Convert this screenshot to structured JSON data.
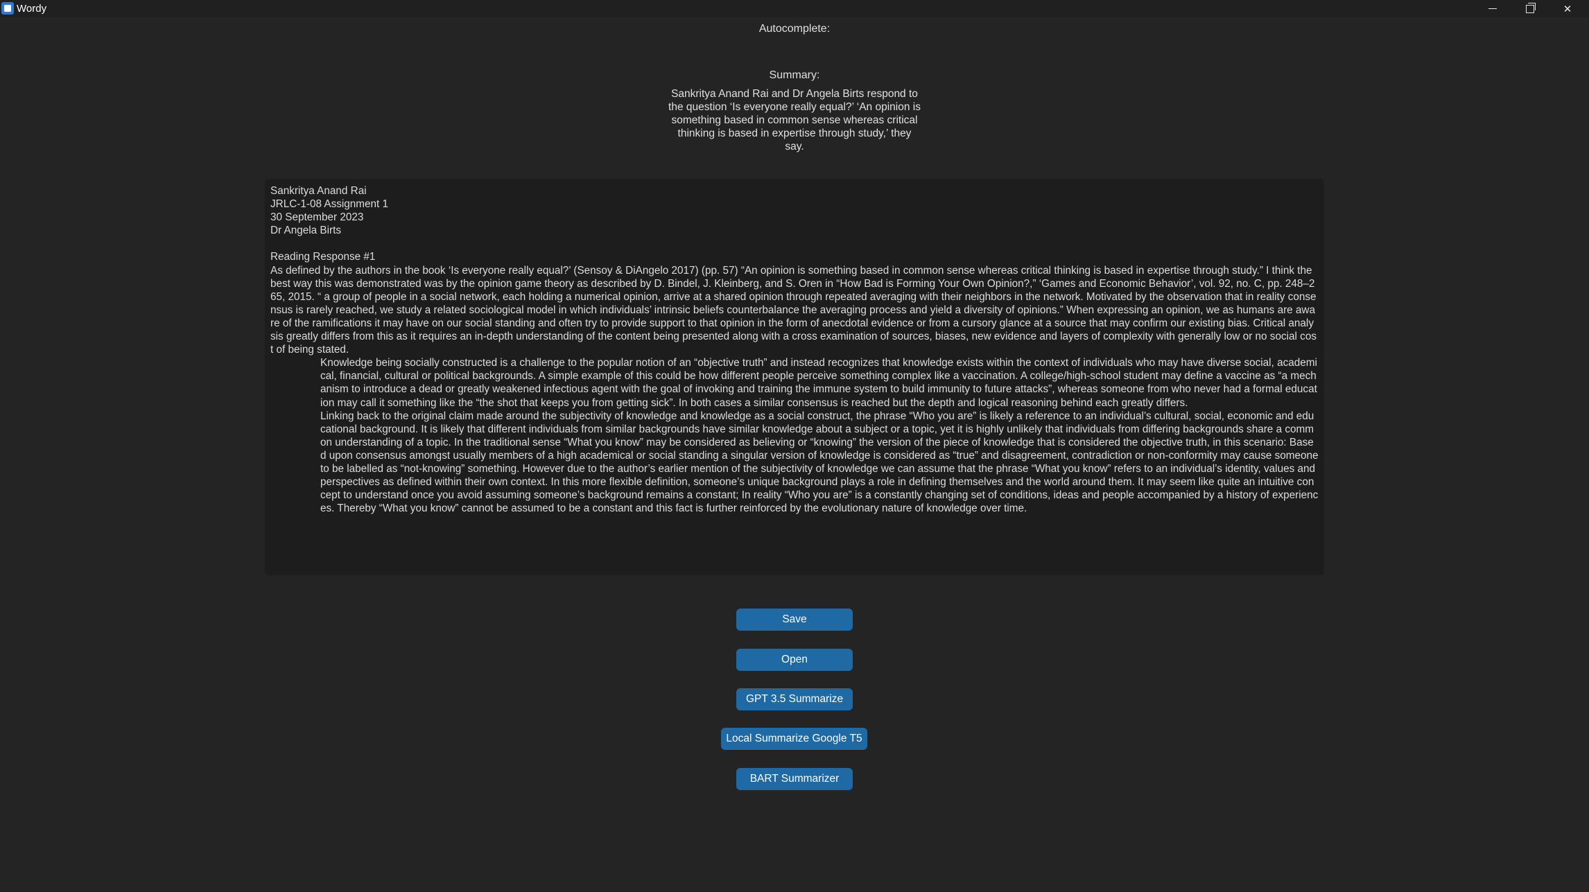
{
  "window": {
    "title": "Wordy",
    "minimize_glyph": "",
    "maximize_glyph": "",
    "close_glyph": "✕"
  },
  "autocomplete": {
    "label": "Autocomplete:"
  },
  "summary": {
    "label": "Summary:",
    "text": "Sankritya Anand Rai and Dr Angela Birts respond to the question ‘Is everyone really equal?’ ‘An opinion is something based in common sense whereas critical thinking is based in expertise through study,’ they say."
  },
  "editor": {
    "header_lines": [
      "Sankritya Anand Rai",
      "JRLC-1-08 Assignment 1",
      "30 September 2023",
      "Dr Angela Birts"
    ],
    "heading": "Reading Response #1",
    "paragraphs": [
      "As defined by the authors in the book ‘Is everyone really equal?’ (Sensoy & DiAngelo 2017) (pp. 57) “An opinion is something based in common sense whereas critical thinking is based in expertise through study.” I think the best way this was demonstrated was by the opinion game theory as described by D. Bindel, J. Kleinberg, and S. Oren in “How Bad is Forming Your Own Opinion?,” ‘Games and Economic Behavior’, vol. 92, no. C, pp. 248–265, 2015. “ a group of people in a social network, each holding a numerical opinion, arrive at a shared opinion through repeated averaging with their neighbors in the network. Motivated by the observation that in reality consensus is rarely reached, we study a related sociological model in which individuals’ intrinsic beliefs counterbalance the averaging process and yield a diversity of opinions.” When expressing an opinion, we as humans are aware of the ramifications it may have on our social standing and often try to provide support to that opinion in the form of anecdotal evidence or from a cursory glance at a source that may confirm our existing bias. Critical analysis greatly differs from this as it requires an in-depth understanding of the content being presented along with a cross examination of sources, biases, new evidence and layers of complexity with generally low or no social cost of being stated.",
      "Knowledge being socially constructed is a challenge to the popular notion of an “objective truth” and instead recognizes that knowledge exists within the context of individuals who may have diverse social, academical, financial, cultural or political backgrounds. A simple example of this could be how different people perceive something complex like a vaccination. A college/high-school student may define a vaccine as “a mechanism to introduce a dead or greatly weakened infectious agent with the goal of invoking and training the immune system to build immunity to future attacks”, whereas someone from who never had a formal education may call it something like the “the shot that keeps you from getting sick”. In both cases a similar consensus is reached but the depth and logical reasoning behind each greatly differs.",
      "Linking back to the original claim made around the subjectivity of knowledge and knowledge as a social construct, the phrase “Who you are” is likely a reference to an individual’s cultural, social, economic and educational background. It is likely that different individuals from similar backgrounds have similar knowledge about a subject or a topic, yet it is highly unlikely that individuals from differing backgrounds share a common understanding of a topic. In the traditional sense “What you know” may be considered as believing or “knowing” the version of the piece of knowledge that is considered the objective truth, in this scenario: Based upon consensus amongst usually members of a high academical or social standing a singular version of knowledge is considered as “true” and disagreement, contradiction or non-conformity may cause someone to be labelled as “not-knowing” something. However due to the author’s earlier mention of the subjectivity of knowledge we can assume that the phrase “What you know” refers to an individual’s identity, values and perspectives as defined within their own context. In this more flexible definition, someone’s unique background plays a role in defining themselves and the world around them. It may seem like quite an intuitive concept to understand once you avoid assuming someone’s background remains a constant; In reality “Who you are” is a constantly changing set of conditions, ideas and people accompanied by a history of experiences. Thereby “What you know” cannot be assumed to be a constant and this fact is further reinforced by the evolutionary nature of knowledge over time."
    ]
  },
  "buttons": {
    "save": "Save",
    "open": "Open",
    "gpt": "GPT 3.5 Summarize",
    "local": "Local Summarize Google T5",
    "bart": "BART Summarizer"
  },
  "colors": {
    "background": "#242424",
    "titlebar": "#202020",
    "editor_bg": "#1d1d1d",
    "button": "#1f6aa5",
    "text": "#dcdcdc"
  }
}
